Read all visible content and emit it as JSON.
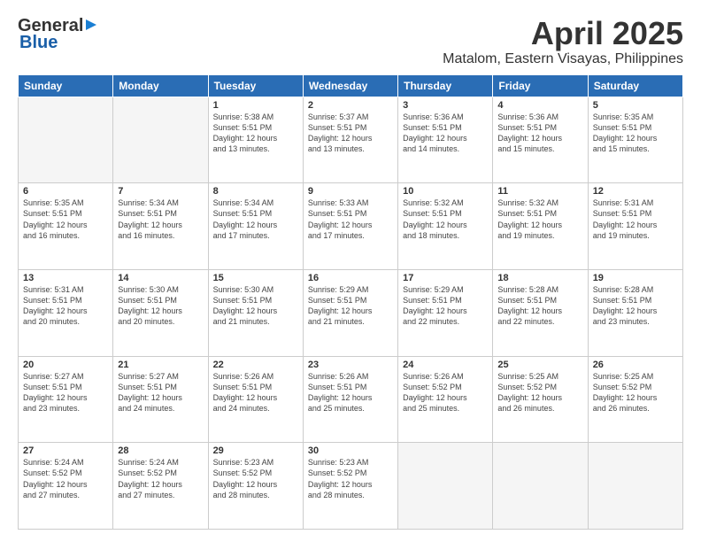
{
  "header": {
    "logo_general": "General",
    "logo_blue": "Blue",
    "month_title": "April 2025",
    "location": "Matalom, Eastern Visayas, Philippines"
  },
  "calendar": {
    "days_of_week": [
      "Sunday",
      "Monday",
      "Tuesday",
      "Wednesday",
      "Thursday",
      "Friday",
      "Saturday"
    ],
    "weeks": [
      [
        {
          "day": "",
          "info": ""
        },
        {
          "day": "",
          "info": ""
        },
        {
          "day": "1",
          "info": "Sunrise: 5:38 AM\nSunset: 5:51 PM\nDaylight: 12 hours\nand 13 minutes."
        },
        {
          "day": "2",
          "info": "Sunrise: 5:37 AM\nSunset: 5:51 PM\nDaylight: 12 hours\nand 13 minutes."
        },
        {
          "day": "3",
          "info": "Sunrise: 5:36 AM\nSunset: 5:51 PM\nDaylight: 12 hours\nand 14 minutes."
        },
        {
          "day": "4",
          "info": "Sunrise: 5:36 AM\nSunset: 5:51 PM\nDaylight: 12 hours\nand 15 minutes."
        },
        {
          "day": "5",
          "info": "Sunrise: 5:35 AM\nSunset: 5:51 PM\nDaylight: 12 hours\nand 15 minutes."
        }
      ],
      [
        {
          "day": "6",
          "info": "Sunrise: 5:35 AM\nSunset: 5:51 PM\nDaylight: 12 hours\nand 16 minutes."
        },
        {
          "day": "7",
          "info": "Sunrise: 5:34 AM\nSunset: 5:51 PM\nDaylight: 12 hours\nand 16 minutes."
        },
        {
          "day": "8",
          "info": "Sunrise: 5:34 AM\nSunset: 5:51 PM\nDaylight: 12 hours\nand 17 minutes."
        },
        {
          "day": "9",
          "info": "Sunrise: 5:33 AM\nSunset: 5:51 PM\nDaylight: 12 hours\nand 17 minutes."
        },
        {
          "day": "10",
          "info": "Sunrise: 5:32 AM\nSunset: 5:51 PM\nDaylight: 12 hours\nand 18 minutes."
        },
        {
          "day": "11",
          "info": "Sunrise: 5:32 AM\nSunset: 5:51 PM\nDaylight: 12 hours\nand 19 minutes."
        },
        {
          "day": "12",
          "info": "Sunrise: 5:31 AM\nSunset: 5:51 PM\nDaylight: 12 hours\nand 19 minutes."
        }
      ],
      [
        {
          "day": "13",
          "info": "Sunrise: 5:31 AM\nSunset: 5:51 PM\nDaylight: 12 hours\nand 20 minutes."
        },
        {
          "day": "14",
          "info": "Sunrise: 5:30 AM\nSunset: 5:51 PM\nDaylight: 12 hours\nand 20 minutes."
        },
        {
          "day": "15",
          "info": "Sunrise: 5:30 AM\nSunset: 5:51 PM\nDaylight: 12 hours\nand 21 minutes."
        },
        {
          "day": "16",
          "info": "Sunrise: 5:29 AM\nSunset: 5:51 PM\nDaylight: 12 hours\nand 21 minutes."
        },
        {
          "day": "17",
          "info": "Sunrise: 5:29 AM\nSunset: 5:51 PM\nDaylight: 12 hours\nand 22 minutes."
        },
        {
          "day": "18",
          "info": "Sunrise: 5:28 AM\nSunset: 5:51 PM\nDaylight: 12 hours\nand 22 minutes."
        },
        {
          "day": "19",
          "info": "Sunrise: 5:28 AM\nSunset: 5:51 PM\nDaylight: 12 hours\nand 23 minutes."
        }
      ],
      [
        {
          "day": "20",
          "info": "Sunrise: 5:27 AM\nSunset: 5:51 PM\nDaylight: 12 hours\nand 23 minutes."
        },
        {
          "day": "21",
          "info": "Sunrise: 5:27 AM\nSunset: 5:51 PM\nDaylight: 12 hours\nand 24 minutes."
        },
        {
          "day": "22",
          "info": "Sunrise: 5:26 AM\nSunset: 5:51 PM\nDaylight: 12 hours\nand 24 minutes."
        },
        {
          "day": "23",
          "info": "Sunrise: 5:26 AM\nSunset: 5:51 PM\nDaylight: 12 hours\nand 25 minutes."
        },
        {
          "day": "24",
          "info": "Sunrise: 5:26 AM\nSunset: 5:52 PM\nDaylight: 12 hours\nand 25 minutes."
        },
        {
          "day": "25",
          "info": "Sunrise: 5:25 AM\nSunset: 5:52 PM\nDaylight: 12 hours\nand 26 minutes."
        },
        {
          "day": "26",
          "info": "Sunrise: 5:25 AM\nSunset: 5:52 PM\nDaylight: 12 hours\nand 26 minutes."
        }
      ],
      [
        {
          "day": "27",
          "info": "Sunrise: 5:24 AM\nSunset: 5:52 PM\nDaylight: 12 hours\nand 27 minutes."
        },
        {
          "day": "28",
          "info": "Sunrise: 5:24 AM\nSunset: 5:52 PM\nDaylight: 12 hours\nand 27 minutes."
        },
        {
          "day": "29",
          "info": "Sunrise: 5:23 AM\nSunset: 5:52 PM\nDaylight: 12 hours\nand 28 minutes."
        },
        {
          "day": "30",
          "info": "Sunrise: 5:23 AM\nSunset: 5:52 PM\nDaylight: 12 hours\nand 28 minutes."
        },
        {
          "day": "",
          "info": ""
        },
        {
          "day": "",
          "info": ""
        },
        {
          "day": "",
          "info": ""
        }
      ]
    ]
  }
}
